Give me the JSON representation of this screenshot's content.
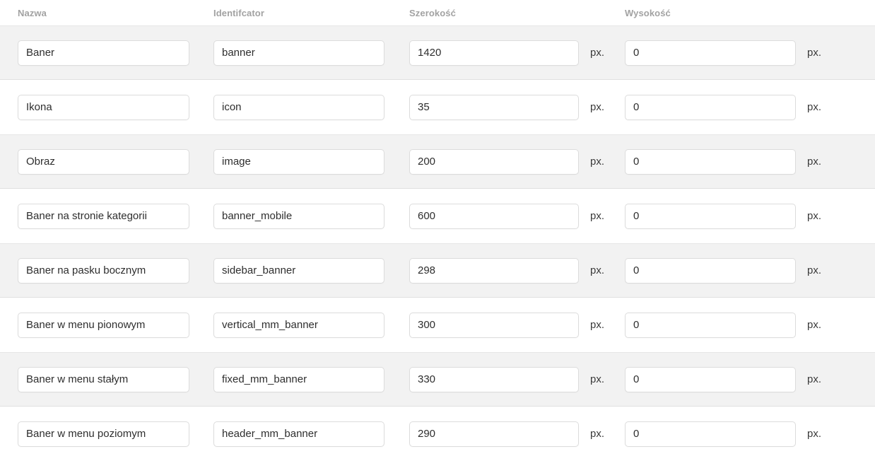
{
  "table": {
    "columns": {
      "name": "Nazwa",
      "identifier": "Identifcator",
      "width": "Szerokość",
      "height": "Wysokość"
    },
    "unit_label": "px.",
    "colors": {
      "stripe_background": "#f2f2f2",
      "row_background": "#ffffff",
      "header_text": "#a2a2a2",
      "field_border": "#dcdcdc",
      "row_divider": "#e0e0e0"
    },
    "rows": [
      {
        "name": "Baner",
        "identifier": "banner",
        "width": "1420",
        "height": "0"
      },
      {
        "name": "Ikona",
        "identifier": "icon",
        "width": "35",
        "height": "0"
      },
      {
        "name": "Obraz",
        "identifier": "image",
        "width": "200",
        "height": "0"
      },
      {
        "name": "Baner na stronie kategorii",
        "identifier": "banner_mobile",
        "width": "600",
        "height": "0"
      },
      {
        "name": "Baner na pasku bocznym",
        "identifier": "sidebar_banner",
        "width": "298",
        "height": "0"
      },
      {
        "name": "Baner w menu pionowym",
        "identifier": "vertical_mm_banner",
        "width": "300",
        "height": "0"
      },
      {
        "name": "Baner w menu stałym",
        "identifier": "fixed_mm_banner",
        "width": "330",
        "height": "0"
      },
      {
        "name": "Baner w menu poziomym",
        "identifier": "header_mm_banner",
        "width": "290",
        "height": "0"
      }
    ]
  }
}
